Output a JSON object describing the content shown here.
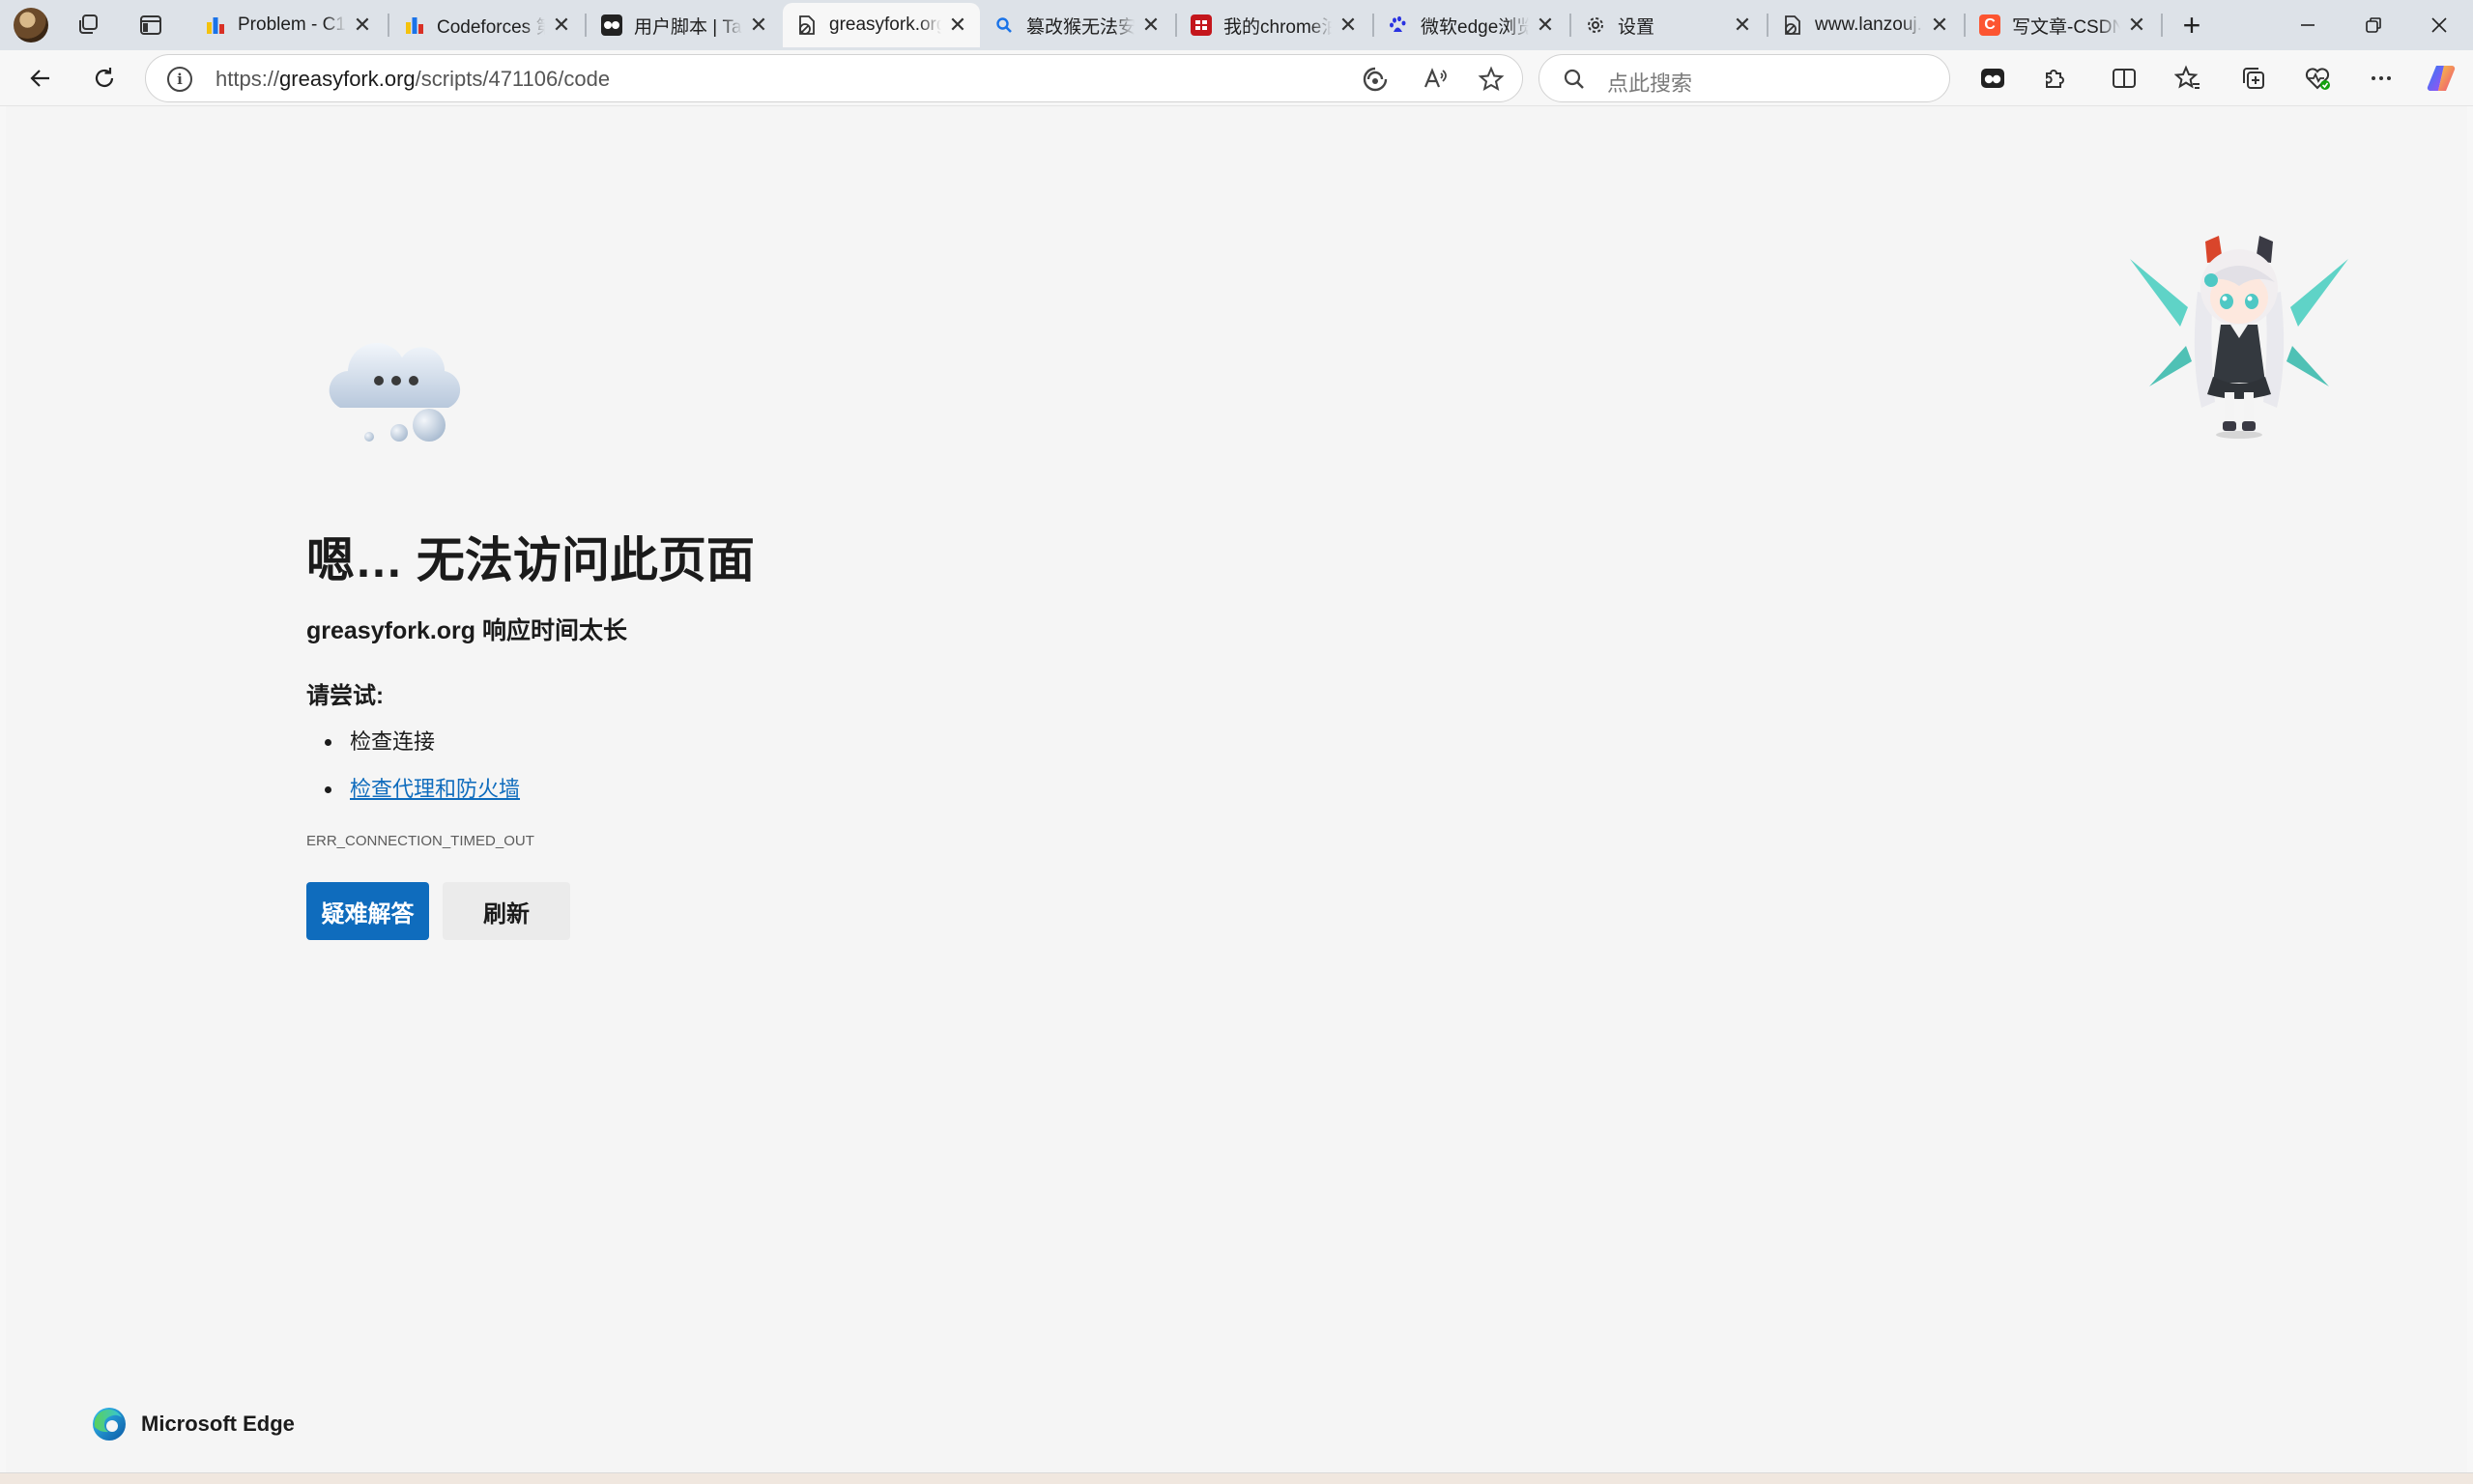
{
  "browser": {
    "tabs": [
      {
        "title": "Problem - C1",
        "favicon": "codeforces-icon",
        "active": false
      },
      {
        "title": "Codeforces 第",
        "favicon": "codeforces-icon",
        "active": false
      },
      {
        "title": "用户脚本 | Tam",
        "favicon": "tampermonkey-icon",
        "active": false
      },
      {
        "title": "greasyfork.org",
        "favicon": "page-error-icon",
        "active": true
      },
      {
        "title": "篡改猴无法安装",
        "favicon": "search-icon",
        "active": false
      },
      {
        "title": "我的chrome油",
        "favicon": "csdn-red-icon",
        "active": false
      },
      {
        "title": "微软edge浏览",
        "favicon": "baidu-paw-icon",
        "active": false
      },
      {
        "title": "设置",
        "favicon": "gear-icon",
        "active": false
      },
      {
        "title": "www.lanzouj.c",
        "favicon": "page-error-icon",
        "active": false
      },
      {
        "title": "写文章-CSDN",
        "favicon": "csdn-icon",
        "active": false
      }
    ],
    "new_tab_label": "+",
    "address": {
      "scheme": "https://",
      "host": "greasyfork.org",
      "path": "/scripts/471106/code"
    },
    "search_placeholder": "点此搜索"
  },
  "error_page": {
    "title": "嗯… 无法访问此页面",
    "subtitle": "greasyfork.org 响应时间太长",
    "try_label": "请尝试:",
    "suggestions": [
      {
        "text": "检查连接",
        "is_link": false
      },
      {
        "text": "检查代理和防火墙",
        "is_link": true
      }
    ],
    "error_code": "ERR_CONNECTION_TIMED_OUT",
    "buttons": {
      "troubleshoot": "疑难解答",
      "refresh": "刷新"
    },
    "brand": "Microsoft Edge"
  },
  "colors": {
    "accent": "#0f6cbd",
    "tabstrip": "#dde2e8",
    "page_background": "#f5f5f5"
  }
}
